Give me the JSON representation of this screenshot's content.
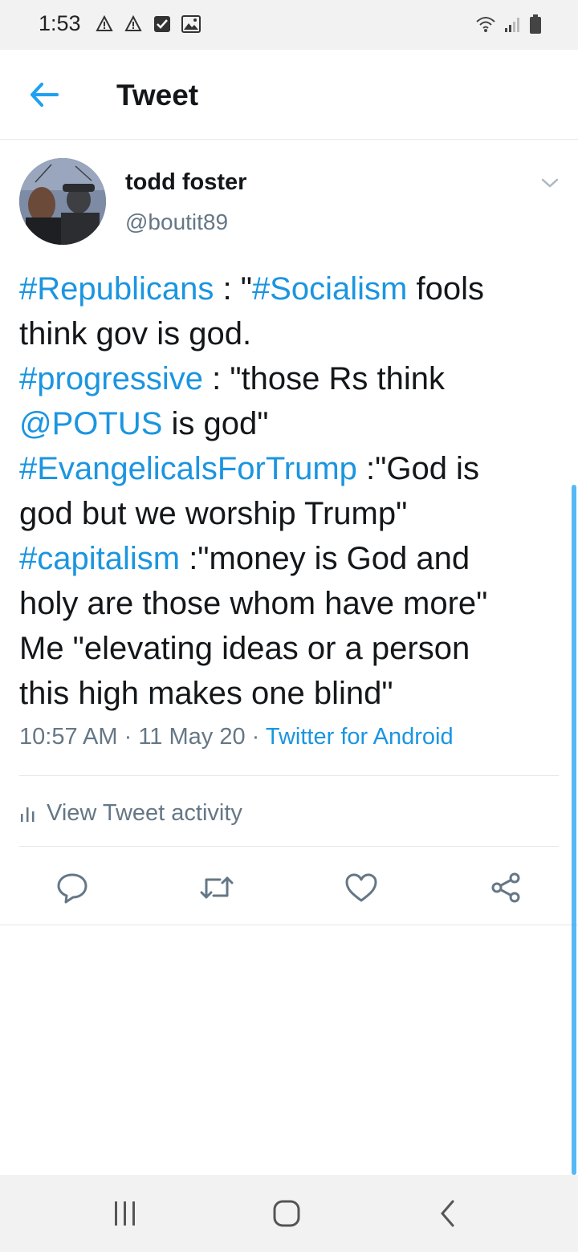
{
  "status_bar": {
    "time": "1:53",
    "notification_icons": [
      "warning-icon",
      "warning-icon",
      "checkbox-icon",
      "image-icon"
    ],
    "system_icons": [
      "wifi-icon",
      "signal-icon",
      "battery-icon"
    ]
  },
  "header": {
    "title": "Tweet",
    "back_icon": "arrow-left-icon"
  },
  "tweet": {
    "author_name": "todd foster",
    "author_handle": "@boutit89",
    "lines": [
      [
        {
          "t": "#Republicans",
          "link": true
        },
        {
          "t": " : \"",
          "link": false
        },
        {
          "t": "#Socialism",
          "link": true
        },
        {
          "t": " fools",
          "link": false
        }
      ],
      [
        {
          "t": "think gov is god.",
          "link": false
        }
      ],
      [
        {
          "t": "#progressive",
          "link": true
        },
        {
          "t": " : \"those Rs think",
          "link": false
        }
      ],
      [
        {
          "t": "@POTUS",
          "link": true
        },
        {
          "t": " is god\"",
          "link": false
        }
      ],
      [
        {
          "t": "#EvangelicalsForTrump",
          "link": true
        },
        {
          "t": " :\"God is",
          "link": false
        }
      ],
      [
        {
          "t": "god but we worship Trump\"",
          "link": false
        }
      ],
      [
        {
          "t": "#capitalism",
          "link": true
        },
        {
          "t": " :\"money is God and",
          "link": false
        }
      ],
      [
        {
          "t": "holy are those whom have more\"",
          "link": false
        }
      ],
      [
        {
          "t": "Me \"elevating ideas or a person",
          "link": false
        }
      ],
      [
        {
          "t": "this high makes one blind\"",
          "link": false
        }
      ]
    ],
    "time": "10:57 AM",
    "date": "11 May 20",
    "separator": "·",
    "source": "Twitter for Android"
  },
  "activity": {
    "label": "View Tweet activity",
    "icon": "bar-chart-icon"
  },
  "actions": {
    "reply_icon": "reply-icon",
    "retweet_icon": "retweet-icon",
    "like_icon": "heart-icon",
    "share_icon": "share-icon"
  },
  "nav_bar": {
    "icons": [
      "recent-apps-icon",
      "home-icon",
      "back-icon"
    ]
  },
  "colors": {
    "accent": "#1da1f2",
    "link": "#1b95e0",
    "secondary_text": "#657786",
    "divider": "#e1e8ed"
  }
}
